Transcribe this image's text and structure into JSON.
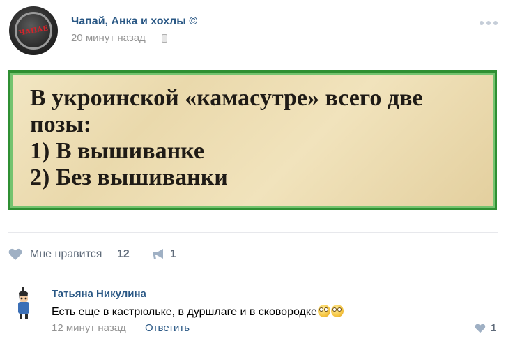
{
  "post": {
    "group_name": "Чапай, Анка и хохлы ©",
    "time": "20 минут назад",
    "avatar_logo_text": "ЧАПАЕ",
    "image_text": "В укроинской «камасутре» всего две\nпозы:\n1) В вышиванке\n2) Без вышиванки",
    "like_label": "Мне нравится",
    "like_count": "12",
    "share_count": "1"
  },
  "comment": {
    "author": "Татьяна Никулина",
    "text": "Есть еще в кастрюльке, в дуршлаге и в сковородке",
    "time": "12 минут назад",
    "reply_label": "Ответить",
    "like_count": "1"
  },
  "icons": {
    "avatar": "group-avatar",
    "mobile": "phone-icon",
    "more": "more-dots-icon",
    "like": "heart-icon",
    "share": "megaphone-icon",
    "emoji": "flushed-face-emoji"
  },
  "colors": {
    "link": "#2a5885",
    "muted": "#939393",
    "frame_green": "#2f8f32"
  }
}
